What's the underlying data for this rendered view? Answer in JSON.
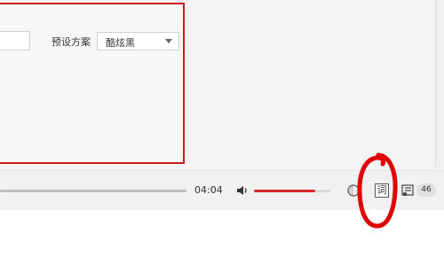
{
  "settings": {
    "preset_label": "预设方案",
    "preset_value": "酷炫黑",
    "left_input_value": ""
  },
  "player": {
    "time": "04:04",
    "volume_level": 0.8,
    "lyrics_button_label": "词",
    "playlist_count": "46"
  },
  "colors": {
    "accent": "#d6262a",
    "annotation_red": "#e00000"
  },
  "icons": [
    "speaker-icon",
    "half-circle-icon",
    "playlist-icon",
    "dropdown-caret-icon"
  ]
}
